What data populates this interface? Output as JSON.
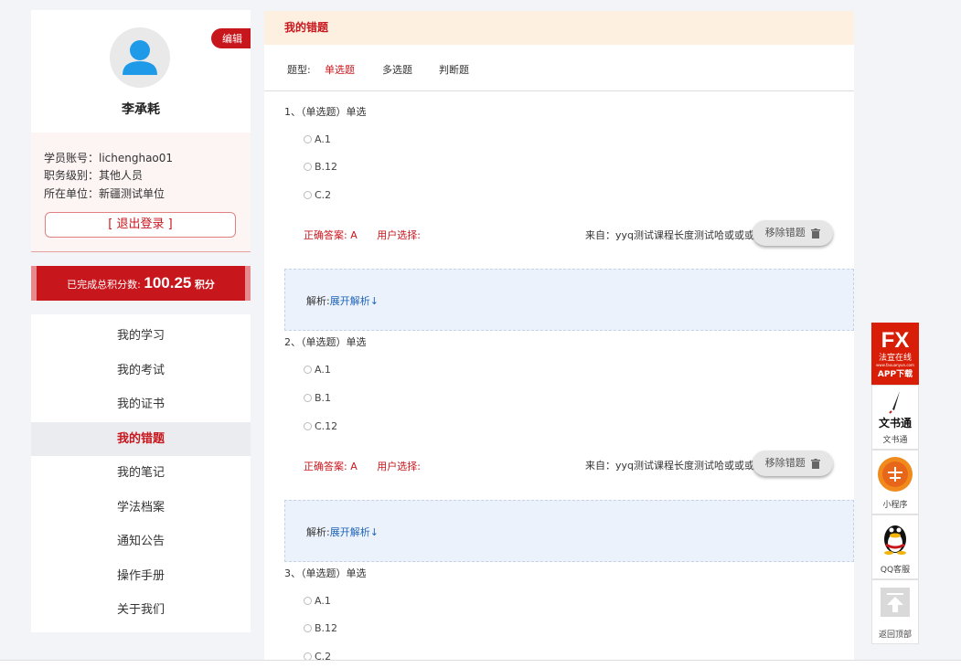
{
  "profile": {
    "edit_label": "编辑",
    "name": "李承耗",
    "account": "学员账号：lichenghao01",
    "level": "职务级别：其他人员",
    "unit": "所在单位：新疆测试单位",
    "logout_label": "[ 退出登录 ]"
  },
  "score": {
    "prefix": "已完成总积分数:",
    "value": "100.25",
    "suffix": "积分"
  },
  "menu": {
    "items": [
      {
        "label": "我的学习"
      },
      {
        "label": "我的考试"
      },
      {
        "label": "我的证书"
      },
      {
        "label": "我的错题"
      },
      {
        "label": "我的笔记"
      },
      {
        "label": "学法档案"
      },
      {
        "label": "通知公告"
      },
      {
        "label": "操作手册"
      },
      {
        "label": "关于我们"
      }
    ],
    "active": "我的错题"
  },
  "main": {
    "title": "我的错题",
    "filter_label": "题型:",
    "filters": [
      "单选题",
      "多选题",
      "判断题"
    ],
    "questions": [
      {
        "title": "1、（单选题）单选",
        "options": [
          "A.1",
          "B.12",
          "C.2"
        ],
        "correct": "正确答案:  A",
        "user_choice": "用户选择:",
        "source": "来自：yyq测试课程长度测试哈或或或...",
        "remove_label": "移除错题",
        "analysis_label": "解析:",
        "expand_label": "展开解析↓"
      },
      {
        "title": "2、（单选题）单选",
        "options": [
          "A.1",
          "B.1",
          "C.12"
        ],
        "correct": "正确答案:  A",
        "user_choice": "用户选择:",
        "source": "来自：yyq测试课程长度测试哈或或或...",
        "remove_label": "移除错题",
        "analysis_label": "解析:",
        "expand_label": "展开解析↓"
      },
      {
        "title": "3、（单选题）单选",
        "options": [
          "A.1",
          "B.12",
          "C.2"
        ]
      }
    ]
  },
  "float": {
    "app": {
      "brand": "法宣在线",
      "sub": "www.faxuanyun.com",
      "caption": "APP下载"
    },
    "wenshu": {
      "logo": "文书通",
      "caption": "文书通"
    },
    "mini": {
      "caption": "小程序"
    },
    "qq": {
      "caption": "QQ客服"
    },
    "top": {
      "caption": "返回顶部"
    }
  }
}
